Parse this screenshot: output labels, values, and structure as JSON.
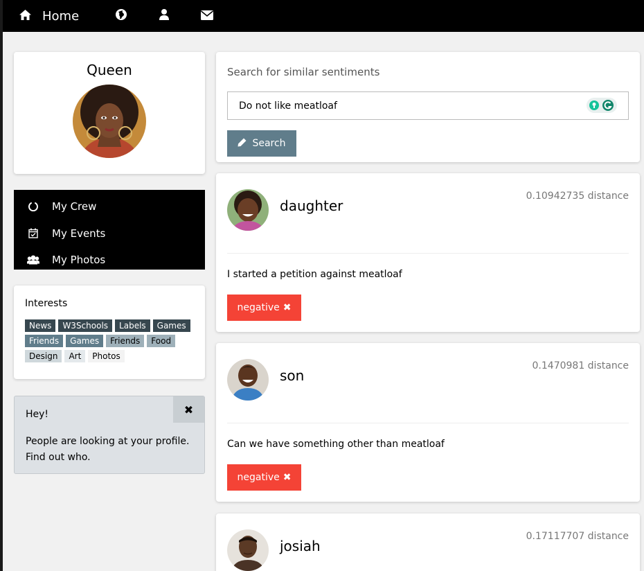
{
  "topbar": {
    "home_label": "Home",
    "icons": [
      "home-icon",
      "globe-icon",
      "user-icon",
      "envelope-icon"
    ]
  },
  "profile": {
    "name": "Queen"
  },
  "menu": {
    "items": [
      {
        "label": "My Crew",
        "icon": "circle-notch-icon"
      },
      {
        "label": "My Events",
        "icon": "calendar-check-icon"
      },
      {
        "label": "My Photos",
        "icon": "users-icon"
      }
    ]
  },
  "interests": {
    "title": "Interests",
    "tags": [
      {
        "label": "News",
        "style": "dark"
      },
      {
        "label": "W3Schools",
        "style": "dark"
      },
      {
        "label": "Labels",
        "style": "dark"
      },
      {
        "label": "Games",
        "style": "dark"
      },
      {
        "label": "Friends",
        "style": "mid"
      },
      {
        "label": "Games",
        "style": "mid"
      },
      {
        "label": "Friends",
        "style": "light"
      },
      {
        "label": "Food",
        "style": "light"
      },
      {
        "label": "Design",
        "style": "pale"
      },
      {
        "label": "Art",
        "style": "paler"
      },
      {
        "label": "Photos",
        "style": "white"
      }
    ]
  },
  "alert": {
    "close": "✖",
    "title": "Hey!",
    "message": "People are looking at your profile. Find out who."
  },
  "search": {
    "label": "Search for similar sentiments",
    "value": "Do not like meatloaf",
    "button": "Search"
  },
  "results": [
    {
      "name": "daughter",
      "distance": "0.10942735 distance",
      "text": "I started a petition against meatloaf",
      "sentiment": "negative"
    },
    {
      "name": "son",
      "distance": "0.1470981 distance",
      "text": "Can we have something other than meatloaf",
      "sentiment": "negative"
    },
    {
      "name": "josiah",
      "distance": "0.17117707 distance",
      "text": "",
      "sentiment": ""
    }
  ],
  "colors": {
    "topbar": "#000000",
    "button": "#607d8b",
    "negative": "#f44336",
    "alert_bg": "#dde1e5"
  }
}
